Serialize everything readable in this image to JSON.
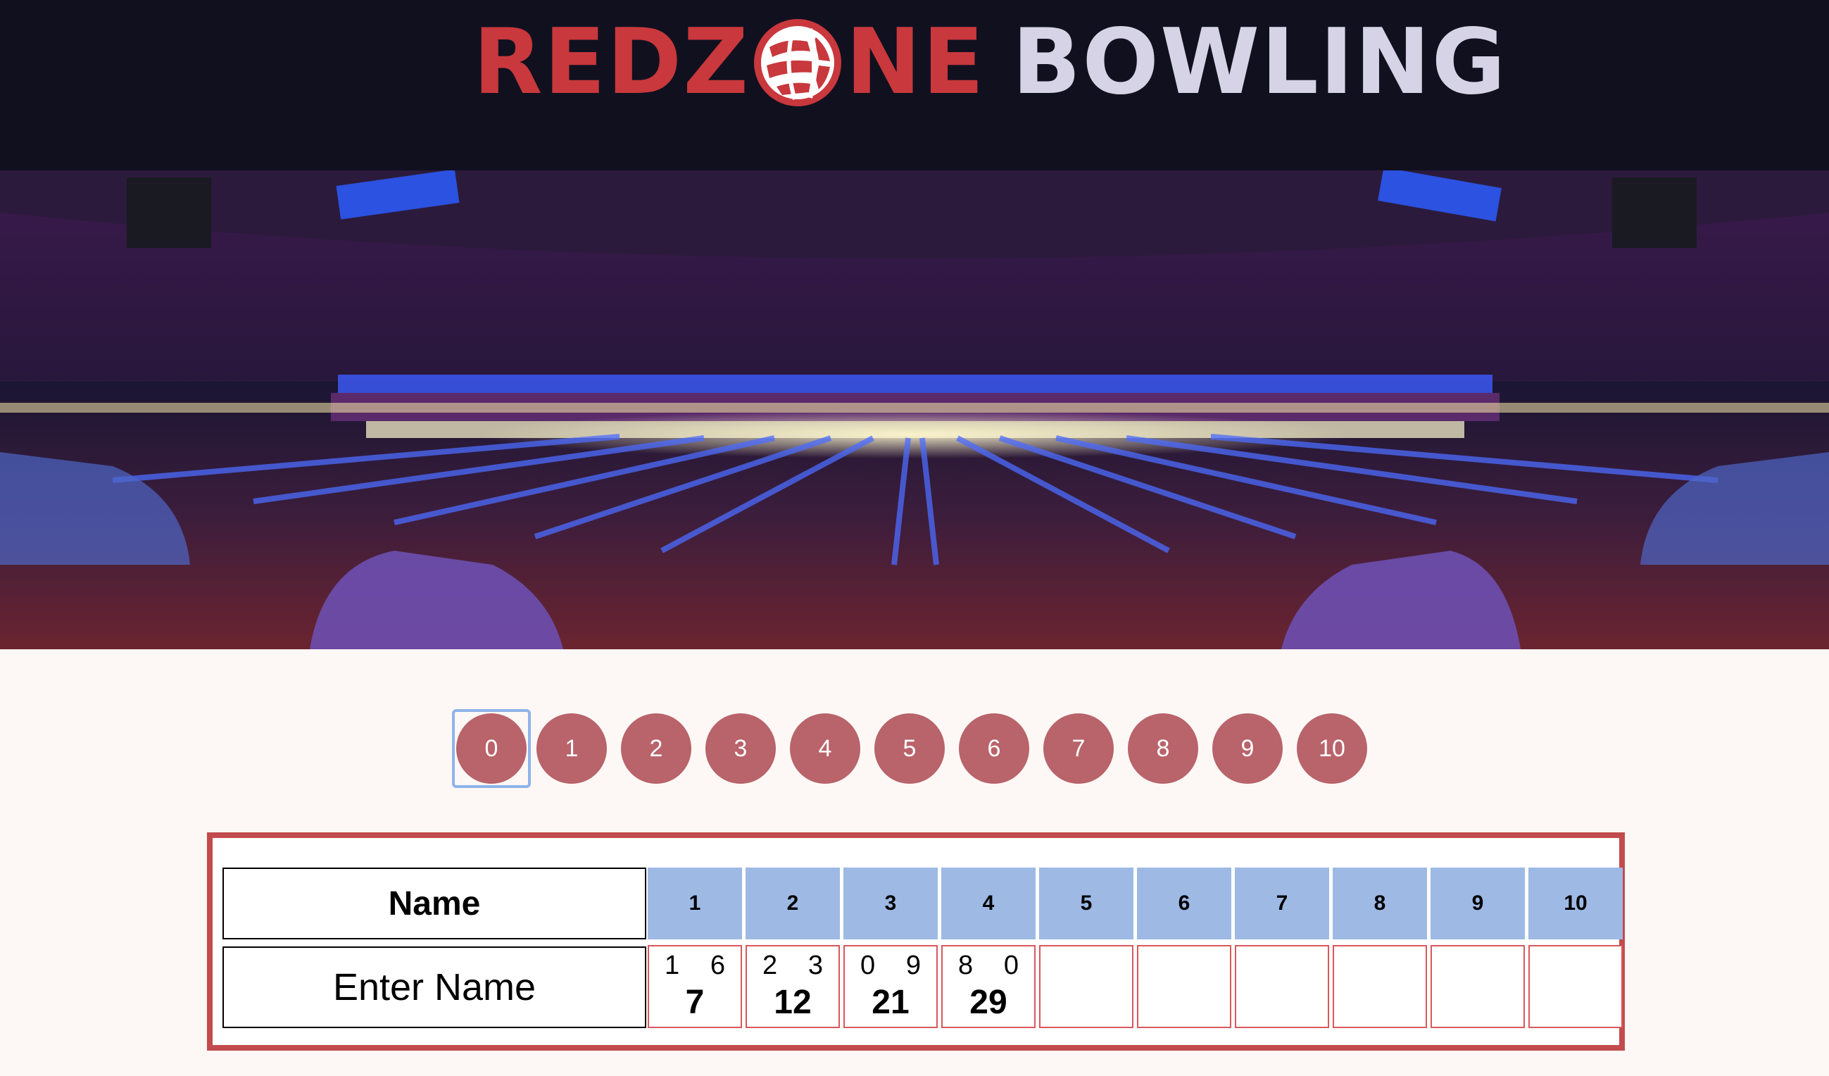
{
  "header": {
    "brand_red": "REDZ",
    "brand_red_tail": "NE",
    "brand_white": "BOWLING",
    "logo_icon": "globe-icon",
    "colors": {
      "red": "#c8383c",
      "white": "#d7d3e6",
      "background": "#11101f"
    }
  },
  "pins": {
    "options": [
      "0",
      "1",
      "2",
      "3",
      "4",
      "5",
      "6",
      "7",
      "8",
      "9",
      "10"
    ],
    "focused": "0",
    "color": "#b9636a"
  },
  "scoreboard": {
    "name_header": "Name",
    "name_value": "Enter Name",
    "frames": [
      {
        "label": "1",
        "roll1": "1",
        "roll2": "6",
        "total": "7"
      },
      {
        "label": "2",
        "roll1": "2",
        "roll2": "3",
        "total": "12"
      },
      {
        "label": "3",
        "roll1": "0",
        "roll2": "9",
        "total": "21"
      },
      {
        "label": "4",
        "roll1": "8",
        "roll2": "0",
        "total": "29"
      },
      {
        "label": "5",
        "roll1": "",
        "roll2": "",
        "total": ""
      },
      {
        "label": "6",
        "roll1": "",
        "roll2": "",
        "total": ""
      },
      {
        "label": "7",
        "roll1": "",
        "roll2": "",
        "total": ""
      },
      {
        "label": "8",
        "roll1": "",
        "roll2": "",
        "total": ""
      },
      {
        "label": "9",
        "roll1": "",
        "roll2": "",
        "total": ""
      },
      {
        "label": "10",
        "roll1": "",
        "roll2": "",
        "total": ""
      }
    ],
    "colors": {
      "border": "#c24b4d",
      "header_fill": "#9eb9e4"
    }
  }
}
